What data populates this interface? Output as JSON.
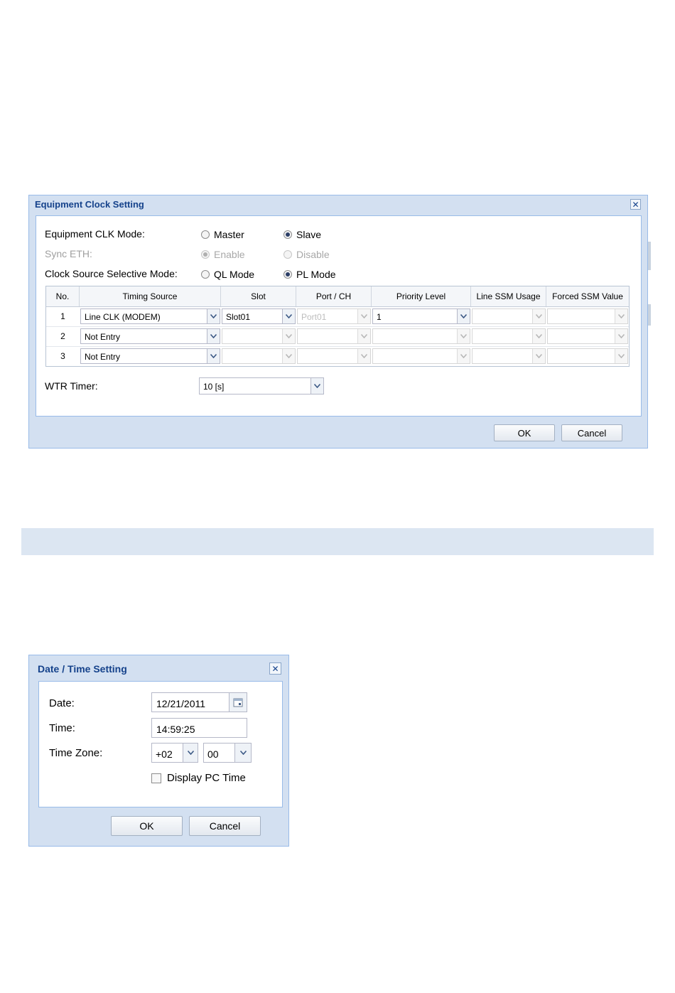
{
  "clock_dialog": {
    "title": "Equipment Clock Setting",
    "clk_mode": {
      "label": "Equipment CLK Mode:",
      "options": [
        {
          "label": "Master",
          "checked": false
        },
        {
          "label": "Slave",
          "checked": true
        }
      ]
    },
    "sync_eth": {
      "label": "Sync ETH:",
      "disabled": true,
      "options": [
        {
          "label": "Enable",
          "checked": true
        },
        {
          "label": "Disable",
          "checked": false
        }
      ]
    },
    "source_mode": {
      "label": "Clock Source Selective Mode:",
      "options": [
        {
          "label": "QL Mode",
          "checked": false
        },
        {
          "label": "PL Mode",
          "checked": true
        }
      ]
    },
    "table": {
      "columns": [
        "No.",
        "Timing Source",
        "Slot",
        "Port / CH",
        "Priority Level",
        "Line SSM Usage",
        "Forced SSM Value"
      ],
      "rows": [
        {
          "no": "1",
          "timing_source": "Line CLK (MODEM)",
          "slot": "Slot01",
          "port": "Port01",
          "priority": "1",
          "line_ssm": "",
          "forced_ssm": ""
        },
        {
          "no": "2",
          "timing_source": "Not Entry",
          "slot": "",
          "port": "",
          "priority": "",
          "line_ssm": "",
          "forced_ssm": ""
        },
        {
          "no": "3",
          "timing_source": "Not Entry",
          "slot": "",
          "port": "",
          "priority": "",
          "line_ssm": "",
          "forced_ssm": ""
        }
      ]
    },
    "wtr": {
      "label": "WTR Timer:",
      "value": "10 [s]"
    },
    "ok_label": "OK",
    "cancel_label": "Cancel"
  },
  "datetime_dialog": {
    "title": "Date / Time Setting",
    "date_label": "Date:",
    "date_value": "12/21/2011",
    "time_label": "Time:",
    "time_value": "14:59:25",
    "tz_label": "Time Zone:",
    "tz_hour": "+02",
    "tz_min": "00",
    "display_pc_time_label": "Display PC Time",
    "display_pc_time_checked": false,
    "ok_label": "OK",
    "cancel_label": "Cancel"
  },
  "colors": {
    "title_text": "#15428b",
    "dialog_frame": "#d3e0f1",
    "band": "#dce6f2"
  }
}
